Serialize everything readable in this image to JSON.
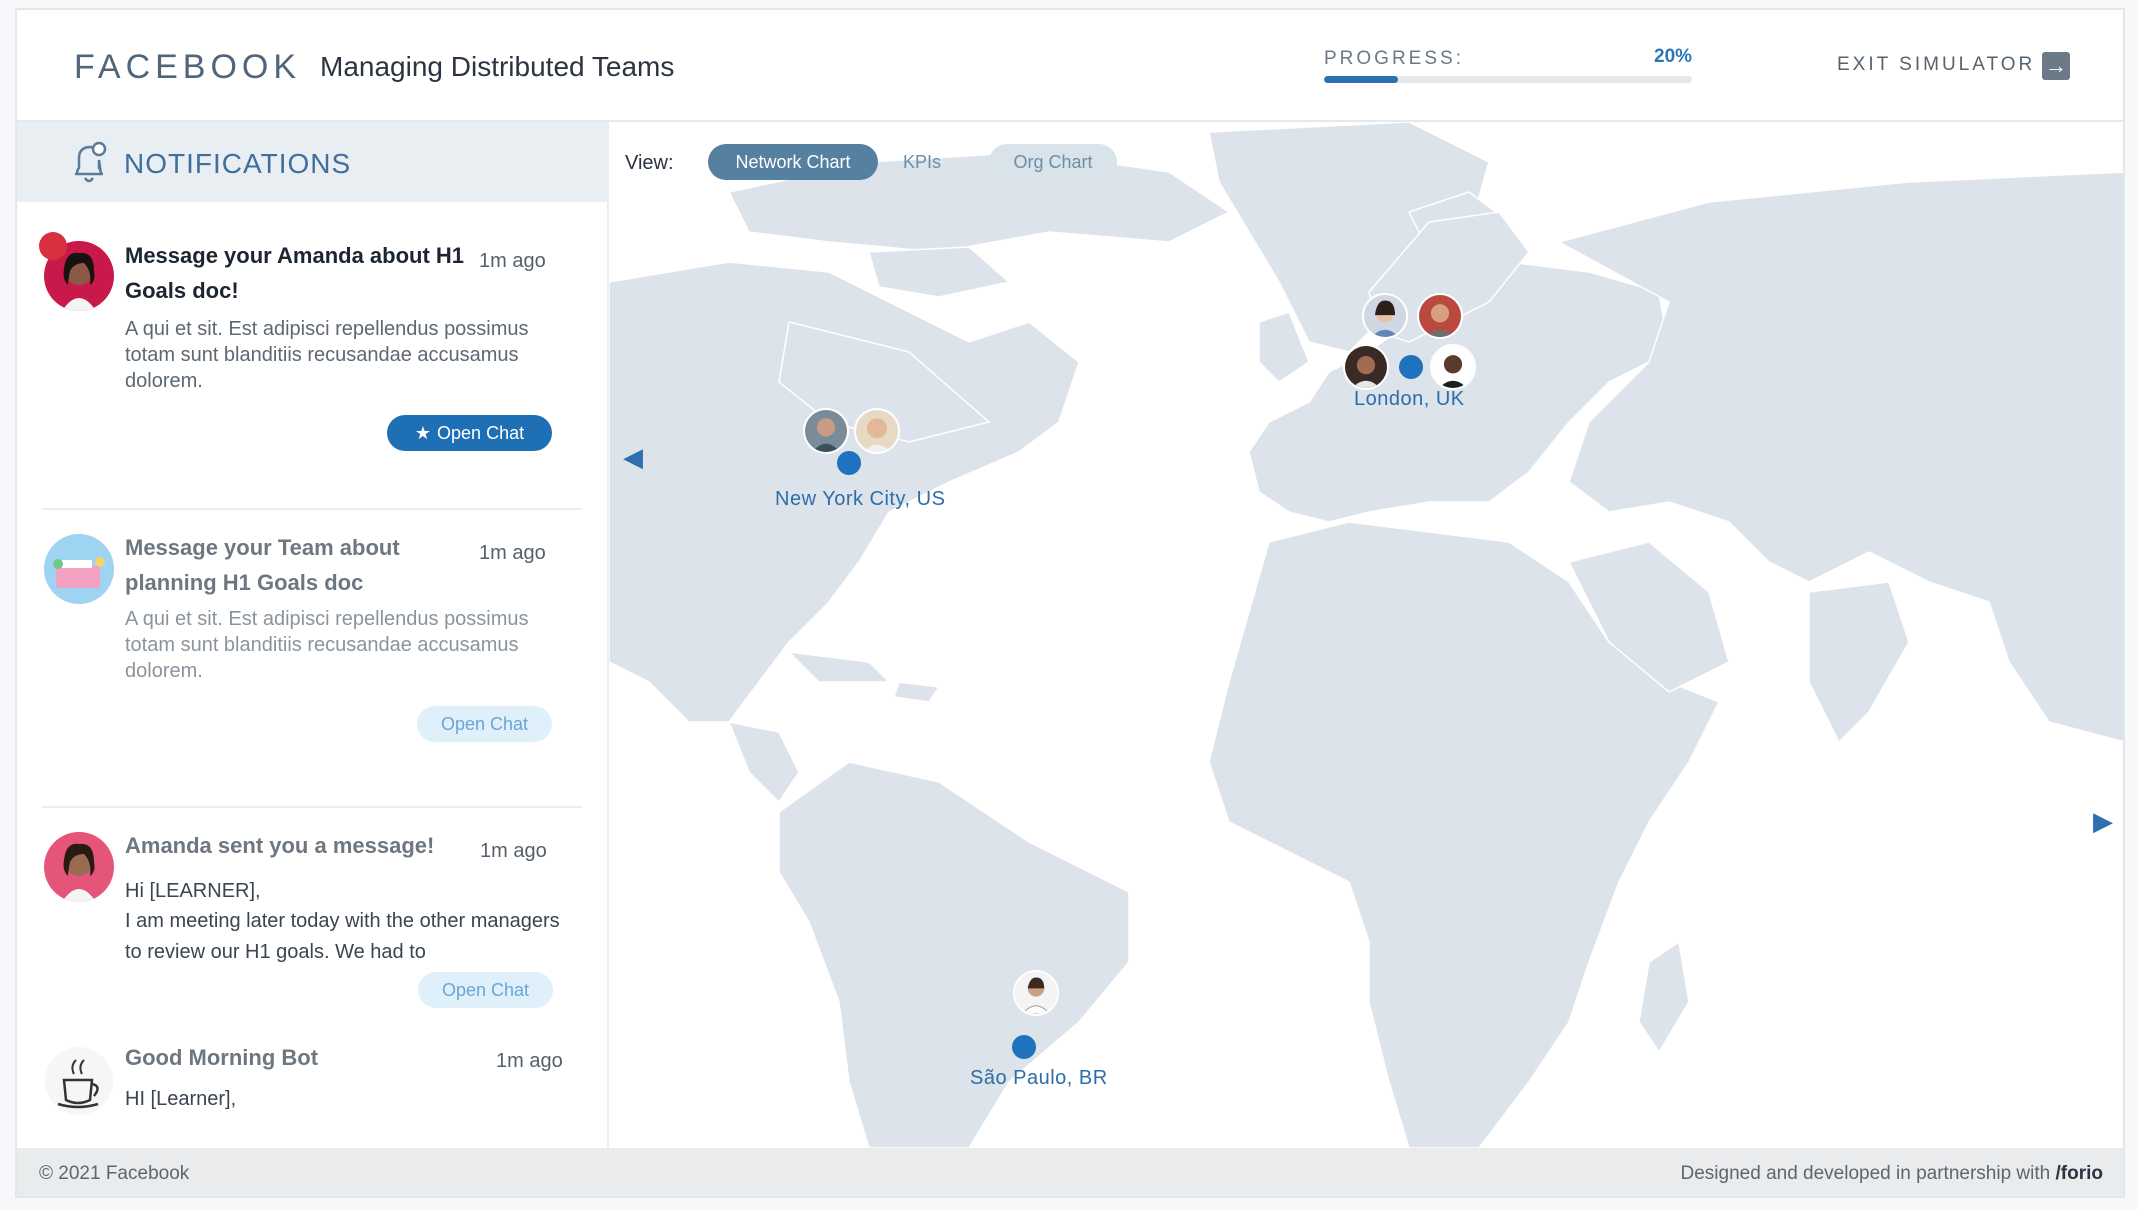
{
  "header": {
    "brand": "FACEBOOK",
    "course_title": "Managing Distributed Teams",
    "progress_label": "PROGRESS:",
    "progress_value": "20%",
    "progress_fraction": 0.2,
    "exit_label": "EXIT SIMULATOR",
    "exit_icon": "exit-arrow-icon"
  },
  "sidebar": {
    "title": "NOTIFICATIONS",
    "icon": "bell-icon",
    "items": [
      {
        "title": "Message your Amanda about H1 Goals doc!",
        "time": "1m ago",
        "body": "A qui et sit. Est adipisci repellendus possimus totam sunt blanditiis recusandae accusamus dolorem.",
        "button": "Open Chat",
        "unread": true
      },
      {
        "title": "Message your Team about planning H1 Goals doc",
        "time": "1m ago",
        "body": "A qui et sit. Est adipisci repellendus possimus totam sunt blanditiis recusandae accusamus dolorem.",
        "button": "Open Chat"
      },
      {
        "title": "Amanda sent you a message!",
        "time": "1m ago",
        "body_line1": "Hi [LEARNER],",
        "body_line2": "I am meeting later today with the other managers to review our H1 goals. We had to",
        "button": "Open Chat"
      },
      {
        "title": "Good Morning Bot",
        "time": "1m ago",
        "body_line1": "HI [Learner],"
      }
    ]
  },
  "map": {
    "view_label": "View:",
    "tabs": [
      "Network Chart",
      "KPIs",
      "Org Chart"
    ],
    "active_tab": "Network Chart",
    "cities": [
      {
        "label": "New York City, US"
      },
      {
        "label": "London, UK"
      },
      {
        "label": "São Paulo, BR"
      }
    ],
    "arrow_left": "chevron-left-icon",
    "arrow_right": "chevron-right-icon",
    "colors": {
      "land": "#dde3ea",
      "ocean": "#ffffff",
      "dot": "#1f72bd"
    }
  },
  "footer": {
    "copyright": "© 2021 Facebook",
    "credit_prefix": "Designed and developed in partnership with ",
    "credit_brand": "/forio"
  }
}
